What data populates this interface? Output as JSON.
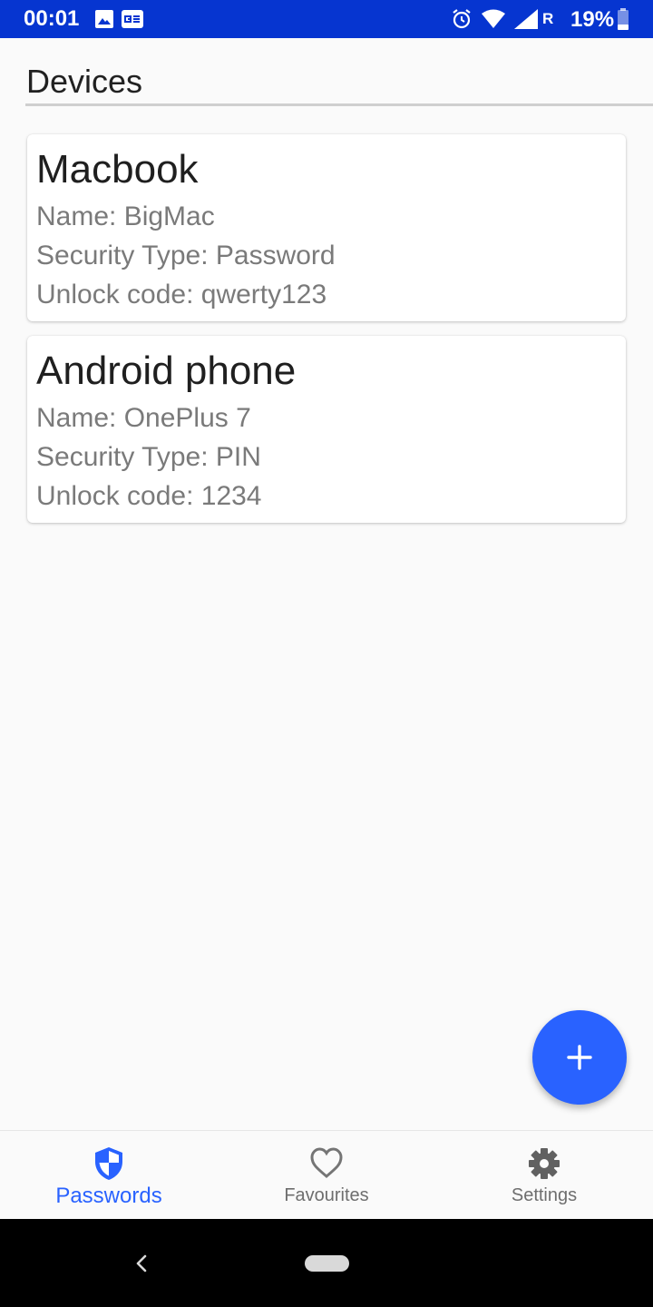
{
  "status_bar": {
    "time": "00:01",
    "roaming": "R",
    "battery": "19%"
  },
  "header": {
    "title": "Devices"
  },
  "devices": [
    {
      "title": "Macbook",
      "name_line": "Name: BigMac",
      "security_line": "Security Type: Password",
      "unlock_line": "Unlock code: qwerty123"
    },
    {
      "title": "Android phone",
      "name_line": "Name: OnePlus 7",
      "security_line": "Security Type: PIN",
      "unlock_line": "Unlock code: 1234"
    }
  ],
  "fab": {
    "icon": "plus-icon"
  },
  "bottom_nav": {
    "items": [
      {
        "label": "Passwords",
        "icon": "shield-icon",
        "active": true
      },
      {
        "label": "Favourites",
        "icon": "heart-icon",
        "active": false
      },
      {
        "label": "Settings",
        "icon": "gear-icon",
        "active": false
      }
    ]
  },
  "colors": {
    "status_bar": "#0635d0",
    "accent": "#2962ff",
    "background": "#fafafa",
    "inactive": "#6e6e6e"
  }
}
